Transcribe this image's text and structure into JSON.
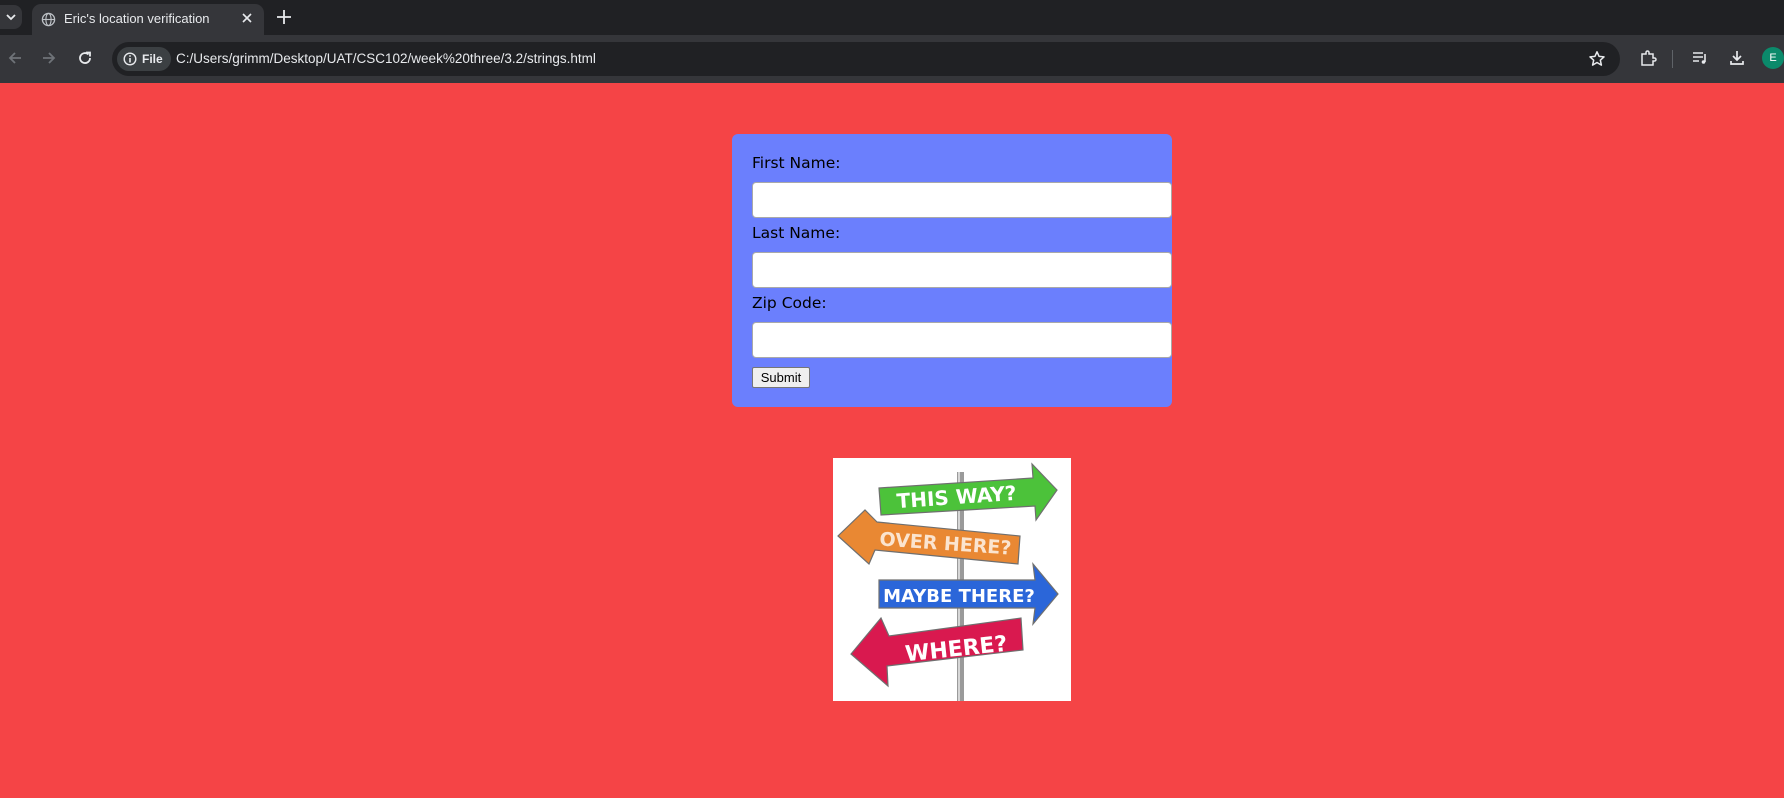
{
  "browser": {
    "tab_title": "Eric's location verification",
    "omnibox_chip": "File",
    "url": "C:/Users/grimm/Desktop/UAT/CSC102/week%20three/3.2/strings.html",
    "profile_initial": "E"
  },
  "form": {
    "first_name_label": "First Name:",
    "last_name_label": "Last Name:",
    "zip_label": "Zip Code:",
    "first_name_value": "",
    "last_name_value": "",
    "zip_value": "",
    "submit_label": "Submit"
  },
  "signpost": {
    "arrow1": "THIS WAY?",
    "arrow2": "OVER HERE?",
    "arrow3": "MAYBE THERE?",
    "arrow4": "WHERE?"
  },
  "colors": {
    "page_background": "#f54446",
    "form_background": "#6b7ffd",
    "arrow1": "#4cc23a",
    "arrow2": "#e98833",
    "arrow3": "#2b66d9",
    "arrow4": "#d9194f"
  }
}
